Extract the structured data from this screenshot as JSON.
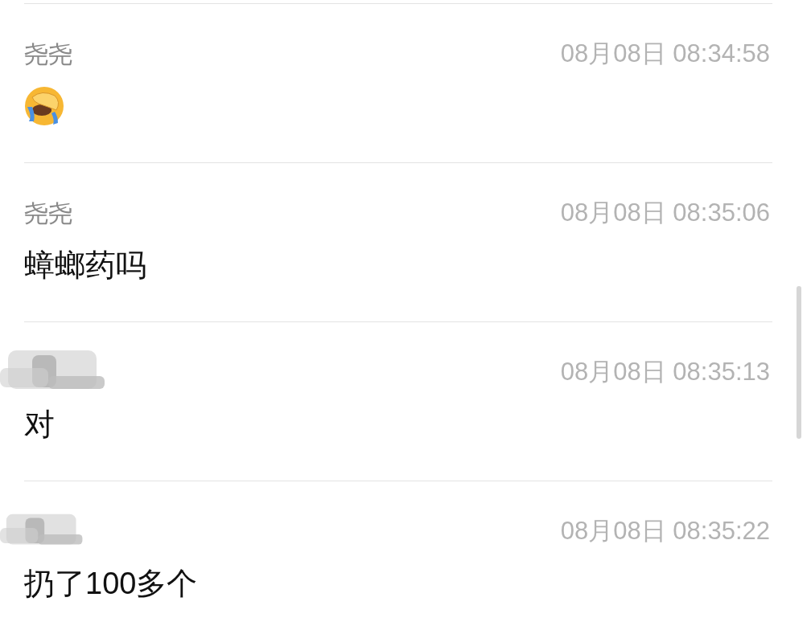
{
  "messages": [
    {
      "sender": "尧尧",
      "sender_hidden": false,
      "time": "08月08日 08:34:58",
      "kind": "emoji"
    },
    {
      "sender": "尧尧",
      "sender_hidden": false,
      "time": "08月08日 08:35:06",
      "kind": "text",
      "text": "蟑螂药吗"
    },
    {
      "sender_hidden": true,
      "time": "08月08日 08:35:13",
      "kind": "text",
      "text": "对"
    },
    {
      "sender_hidden": true,
      "time": "08月08日 08:35:22",
      "kind": "text",
      "text": "扔了100多个"
    }
  ]
}
